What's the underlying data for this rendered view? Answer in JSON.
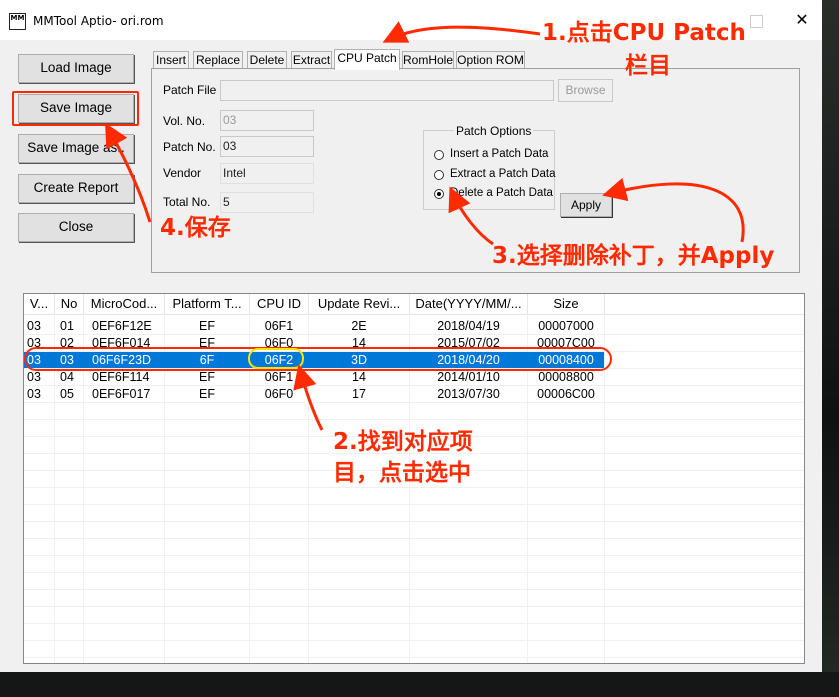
{
  "window": {
    "title": "MMTool Aptio- ori.rom",
    "icon_text": "MM",
    "max_label": "",
    "close_label": "✕"
  },
  "side_buttons": [
    "Load Image",
    "Save Image",
    "Save Image as..",
    "Create Report",
    "Close"
  ],
  "tabs": [
    "Insert",
    "Replace",
    "Delete",
    "Extract",
    "CPU Patch",
    "RomHole",
    "Option ROM"
  ],
  "active_tab": "CPU Patch",
  "form": {
    "patch_file_label": "Patch File",
    "patch_file_value": "",
    "browse_label": "Browse",
    "vol_no_label": "Vol. No.",
    "vol_no_value": "03",
    "patch_no_label": "Patch No.",
    "patch_no_value": "03",
    "vendor_label": "Vendor",
    "vendor_value": "Intel",
    "total_no_label": "Total No.",
    "total_no_value": "5"
  },
  "patch_options": {
    "title": "Patch Options",
    "options": [
      "Insert a Patch Data",
      "Extract a Patch Data",
      "Delete a Patch Data"
    ],
    "selected": "Delete a Patch Data"
  },
  "apply_label": "Apply",
  "table": {
    "columns": [
      "V...",
      "No",
      "MicroCod...",
      "Platform T...",
      "CPU ID",
      "Update Revi...",
      "Date(YYYY/MM/...",
      "Size"
    ],
    "rows": [
      [
        "03",
        "01",
        "0EF6F12E",
        "EF",
        "06F1",
        "2E",
        "2018/04/19",
        "00007000"
      ],
      [
        "03",
        "02",
        "0EF6F014",
        "EF",
        "06F0",
        "14",
        "2015/07/02",
        "00007C00"
      ],
      [
        "03",
        "03",
        "06F6F23D",
        "6F",
        "06F2",
        "3D",
        "2018/04/20",
        "00008400"
      ],
      [
        "03",
        "04",
        "0EF6F114",
        "EF",
        "06F1",
        "14",
        "2014/01/10",
        "00008800"
      ],
      [
        "03",
        "05",
        "0EF6F017",
        "EF",
        "06F0",
        "17",
        "2013/07/30",
        "00006C00"
      ]
    ],
    "selected_row": 2
  },
  "annotations": {
    "step1_line1": "1.点击CPU Patch",
    "step1_line2": "栏目",
    "step2_line1": "2.找到对应项",
    "step2_line2": "目，点击选中",
    "step3": "3.选择删除补丁，并Apply",
    "step4": "4.保存"
  },
  "colors": {
    "annotation": "#ff2a00",
    "selection": "#0078d7",
    "highlight_ring": "#f5e600"
  }
}
